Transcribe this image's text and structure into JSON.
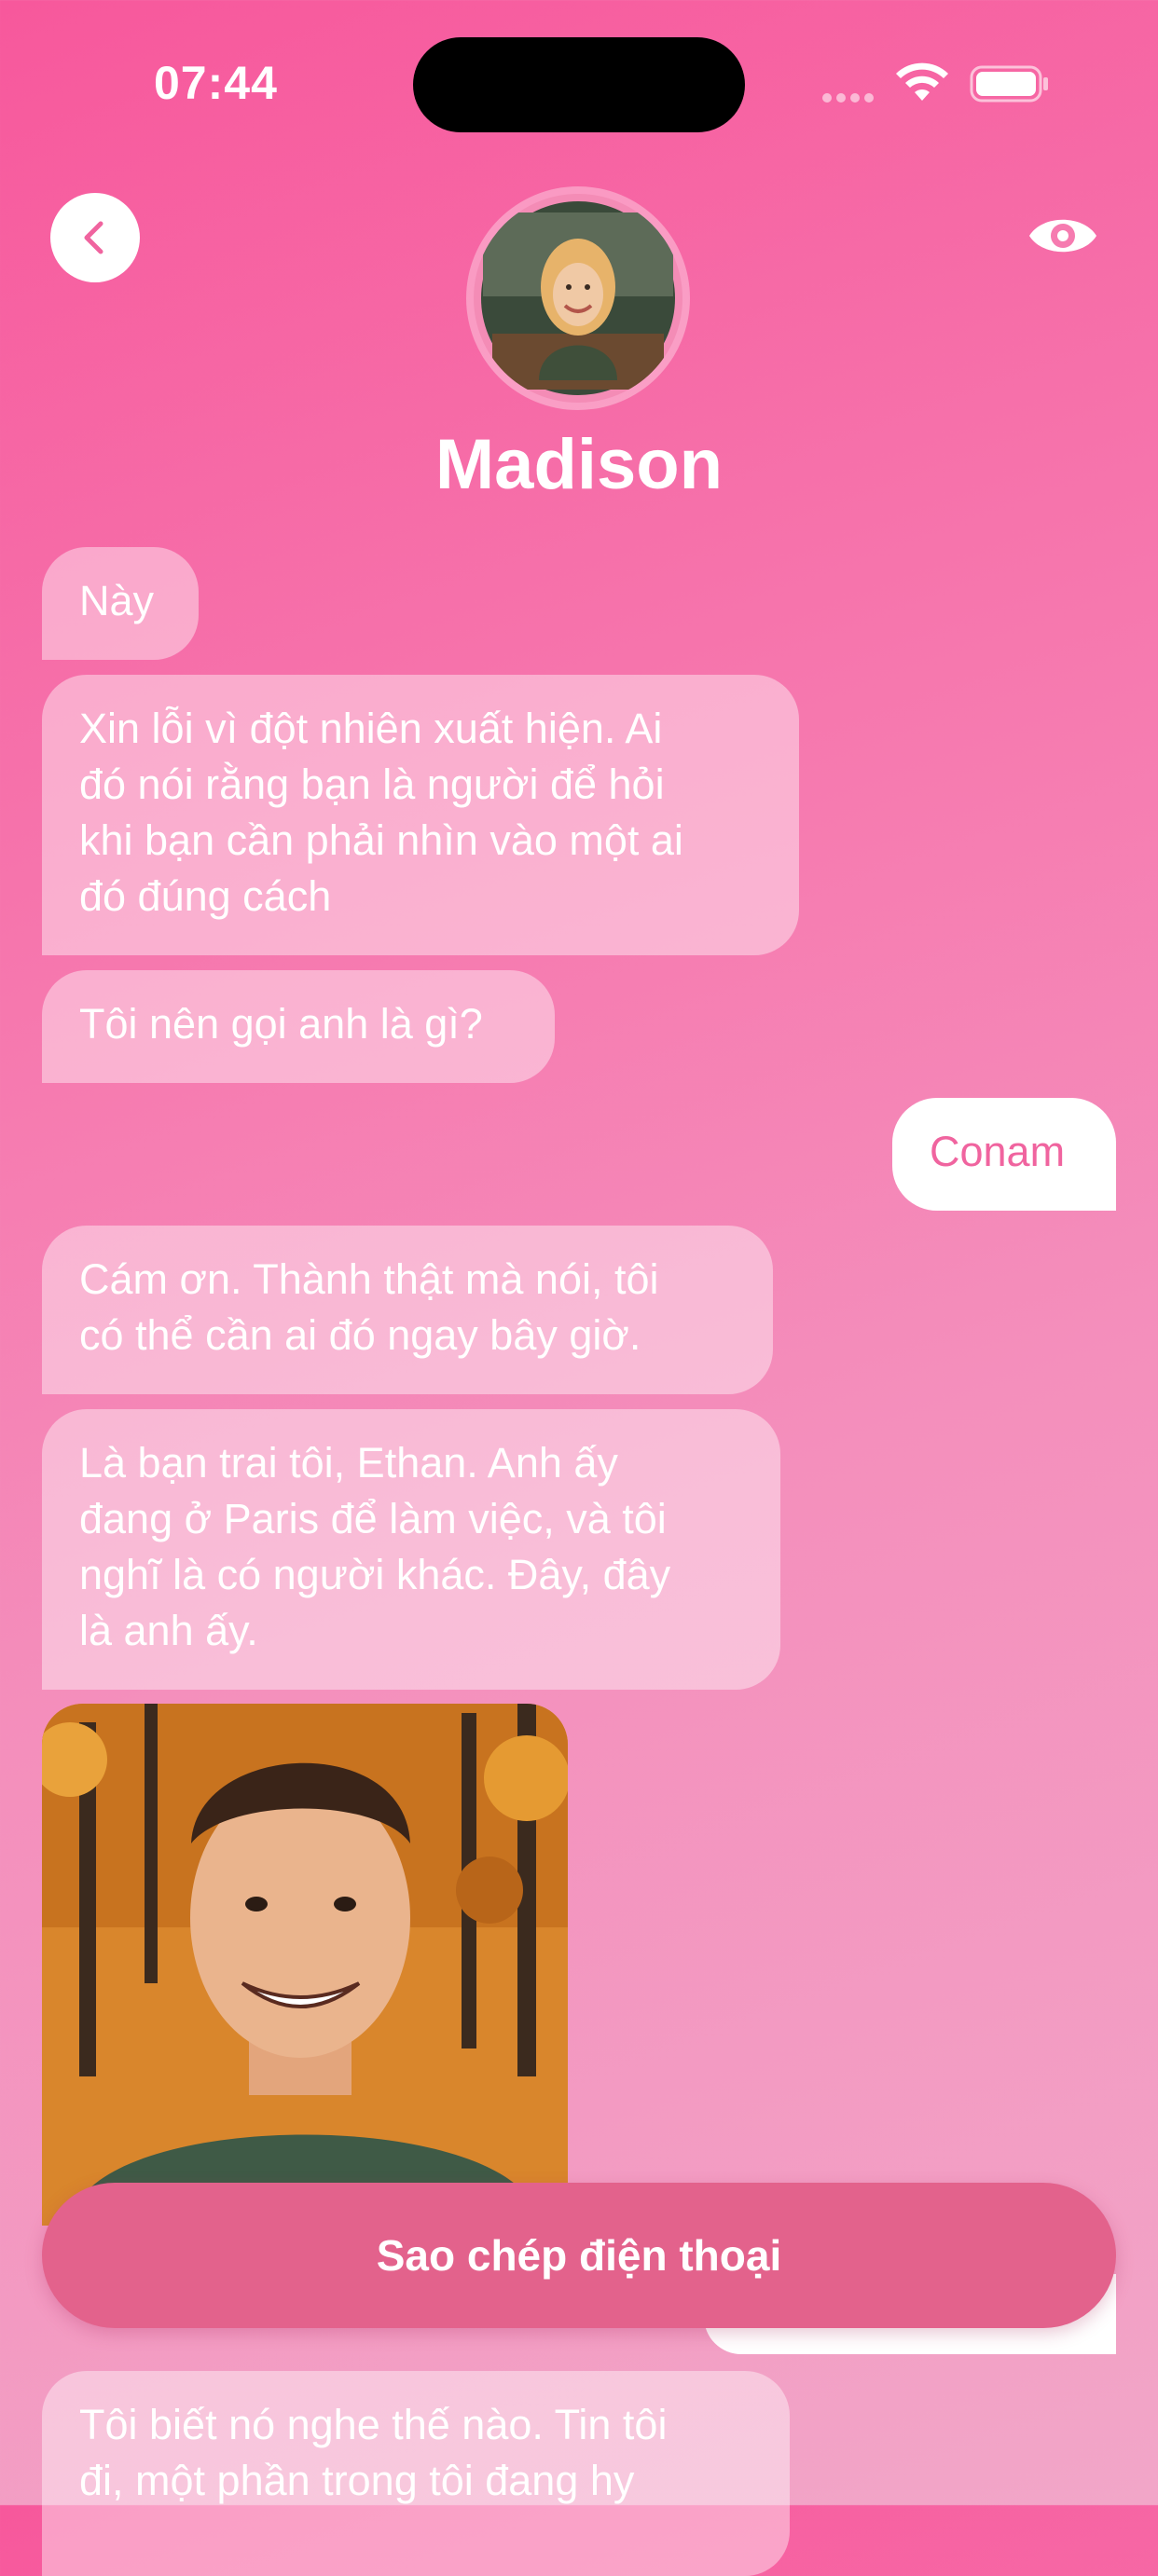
{
  "status_bar": {
    "time": "07:44"
  },
  "header": {
    "back_icon": "chevron-left-icon",
    "view_icon": "eye-icon",
    "contact_name": "Madison"
  },
  "messages": [
    {
      "direction": "in",
      "text": "Này"
    },
    {
      "direction": "in",
      "text": "Xin lỗi vì đột nhiên xuất hiện. Ai\nđó nói rằng bạn là người để hỏi\nkhi bạn cần phải nhìn vào một ai\nđó đúng cách"
    },
    {
      "direction": "in",
      "text": "Tôi nên gọi anh là gì?"
    },
    {
      "direction": "out",
      "text": "Conam"
    },
    {
      "direction": "in",
      "text": "Cám ơn. Thành thật mà nói, tôi\ncó thể cần ai đó ngay bây giờ."
    },
    {
      "direction": "in",
      "text": "Là bạn trai tôi, Ethan. Anh ấy\nđang ở Paris để làm việc, và tôi\nnghĩ là có người khác. Đây, đây\nlà anh ấy."
    },
    {
      "direction": "in",
      "type": "image"
    },
    {
      "direction": "in",
      "text": "Tôi biết nó nghe thế nào. Tin tôi\nđi, một phần trong tôi đang hy"
    }
  ],
  "actions": {
    "copy_phone_label": "Sao chép điện thoại"
  },
  "colors": {
    "background_top": "#f7589c",
    "background_bottom": "#f2a6c8",
    "outgoing_text": "#f0649f",
    "button": "#e3628c"
  }
}
